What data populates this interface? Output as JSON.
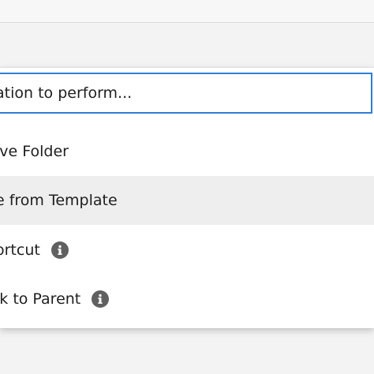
{
  "palette": {
    "input_border": "#2e7ed4",
    "selected_row": "#efeeef",
    "info_icon": "#606060"
  },
  "search": {
    "value": "ation to perform..."
  },
  "items": [
    {
      "label": "ive Folder",
      "selected": false,
      "has_info": false
    },
    {
      "label": "e from Template",
      "selected": true,
      "has_info": false
    },
    {
      "label": "ortcut",
      "selected": false,
      "has_info": true,
      "icon": "info-icon"
    },
    {
      "label": "ık to Parent",
      "selected": false,
      "has_info": true,
      "icon": "info-icon"
    }
  ]
}
